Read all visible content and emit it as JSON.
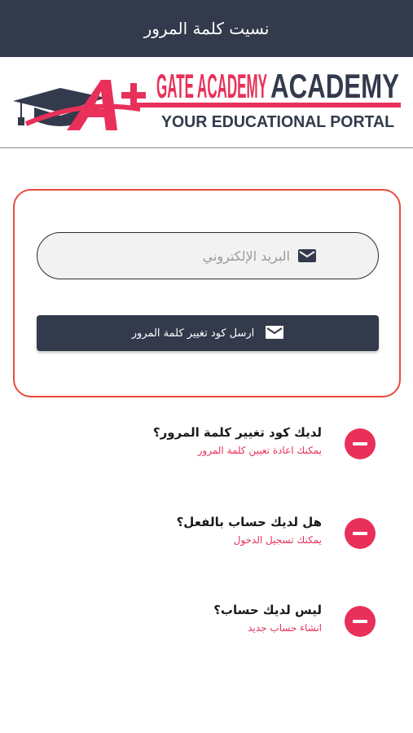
{
  "appbar": {
    "title": "نسيت كلمة المرور"
  },
  "logo": {
    "brand": "GATE ACADEMY",
    "tagline": "YOUR EDUCATIONAL PORTAL",
    "mark": "A+",
    "colors": {
      "red": "#e8305a",
      "dark": "#323a4c"
    }
  },
  "form": {
    "email_placeholder": "البريد الإلكتروني",
    "email_value": "",
    "send_label": "ارسل كود تغيير كلمة المرور",
    "icon": "mail-icon"
  },
  "options": [
    {
      "title": "لديك كود تغيير كلمة المرور؟",
      "subtitle": "يمكنك اعادة تعيين كلمة المرور",
      "icon": "minus-circle-icon"
    },
    {
      "title": "هل لديك حساب بالفعل؟",
      "subtitle": "يمكنك تسجيل الدخول",
      "icon": "minus-circle-icon"
    },
    {
      "title": "ليس لديك حساب؟",
      "subtitle": "انشاء حساب جديد",
      "icon": "minus-circle-icon"
    }
  ],
  "colors": {
    "appbar": "#323a4c",
    "accent": "#e8305a",
    "card_border": "#ea4a3a"
  }
}
